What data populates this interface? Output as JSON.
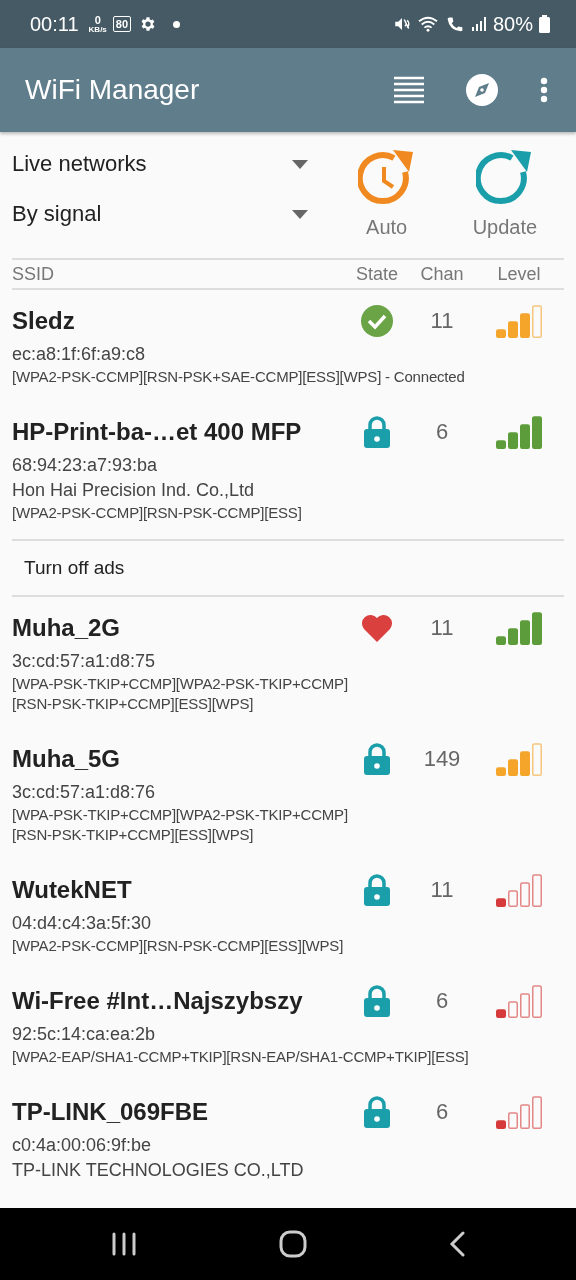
{
  "status_bar": {
    "time": "00:11",
    "speed_value": "0",
    "speed_unit": "KB/s",
    "badge": "80",
    "battery": "80%"
  },
  "app_bar": {
    "title": "WiFi Manager"
  },
  "filters": [
    {
      "label": "Live networks"
    },
    {
      "label": "By signal"
    }
  ],
  "actions": [
    {
      "kind": "auto",
      "label": "Auto"
    },
    {
      "kind": "update",
      "label": "Update"
    }
  ],
  "columns": [
    "SSID",
    "State",
    "Chan",
    "Level"
  ],
  "networks": [
    {
      "ssid": "Sledz",
      "state": {
        "kind": "connected"
      },
      "channel": "11",
      "signal": {
        "kind": "medium"
      },
      "lines": [
        "ec:a8:1f:6f:a9:c8"
      ],
      "security": [
        "[WPA2-PSK-CCMP][RSN-PSK+SAE-CCMP][ESS][WPS] - Connected"
      ]
    },
    {
      "ssid": "HP-Print-ba-…et 400 MFP",
      "state": {
        "kind": "locked"
      },
      "channel": "6",
      "signal": {
        "kind": "strong"
      },
      "lines": [
        "68:94:23:a7:93:ba",
        "Hon Hai Precision Ind. Co.,Ltd"
      ],
      "security": [
        "[WPA2-PSK-CCMP][RSN-PSK-CCMP][ESS]"
      ]
    },
    {
      "kind": "ad",
      "label": "Turn off ads"
    },
    {
      "ssid": "Muha_2G",
      "state": {
        "kind": "favorite"
      },
      "channel": "11",
      "signal": {
        "kind": "strong"
      },
      "lines": [
        "3c:cd:57:a1:d8:75"
      ],
      "security": [
        "[WPA-PSK-TKIP+CCMP][WPA2-PSK-TKIP+CCMP]",
        "[RSN-PSK-TKIP+CCMP][ESS][WPS]"
      ]
    },
    {
      "ssid": "Muha_5G",
      "state": {
        "kind": "locked"
      },
      "channel": "149",
      "signal": {
        "kind": "medium"
      },
      "lines": [
        "3c:cd:57:a1:d8:76"
      ],
      "security": [
        "[WPA-PSK-TKIP+CCMP][WPA2-PSK-TKIP+CCMP]",
        "[RSN-PSK-TKIP+CCMP][ESS][WPS]"
      ]
    },
    {
      "ssid": "WutekNET",
      "state": {
        "kind": "locked"
      },
      "channel": "11",
      "signal": {
        "kind": "weak"
      },
      "lines": [
        "04:d4:c4:3a:5f:30"
      ],
      "security": [
        "[WPA2-PSK-CCMP][RSN-PSK-CCMP][ESS][WPS]"
      ]
    },
    {
      "ssid": "Wi-Free #Int…Najszybszy",
      "state": {
        "kind": "locked"
      },
      "channel": "6",
      "signal": {
        "kind": "weak"
      },
      "lines": [
        "92:5c:14:ca:ea:2b"
      ],
      "security": [
        "[WPA2-EAP/SHA1-CCMP+TKIP][RSN-EAP/SHA1-CCMP+TKIP][ESS]"
      ]
    },
    {
      "ssid": "TP-LINK_069FBE",
      "state": {
        "kind": "locked"
      },
      "channel": "6",
      "signal": {
        "kind": "weak"
      },
      "lines": [
        "c0:4a:00:06:9f:be",
        "TP-LINK TECHNOLOGIES CO.,LTD"
      ]
    }
  ]
}
